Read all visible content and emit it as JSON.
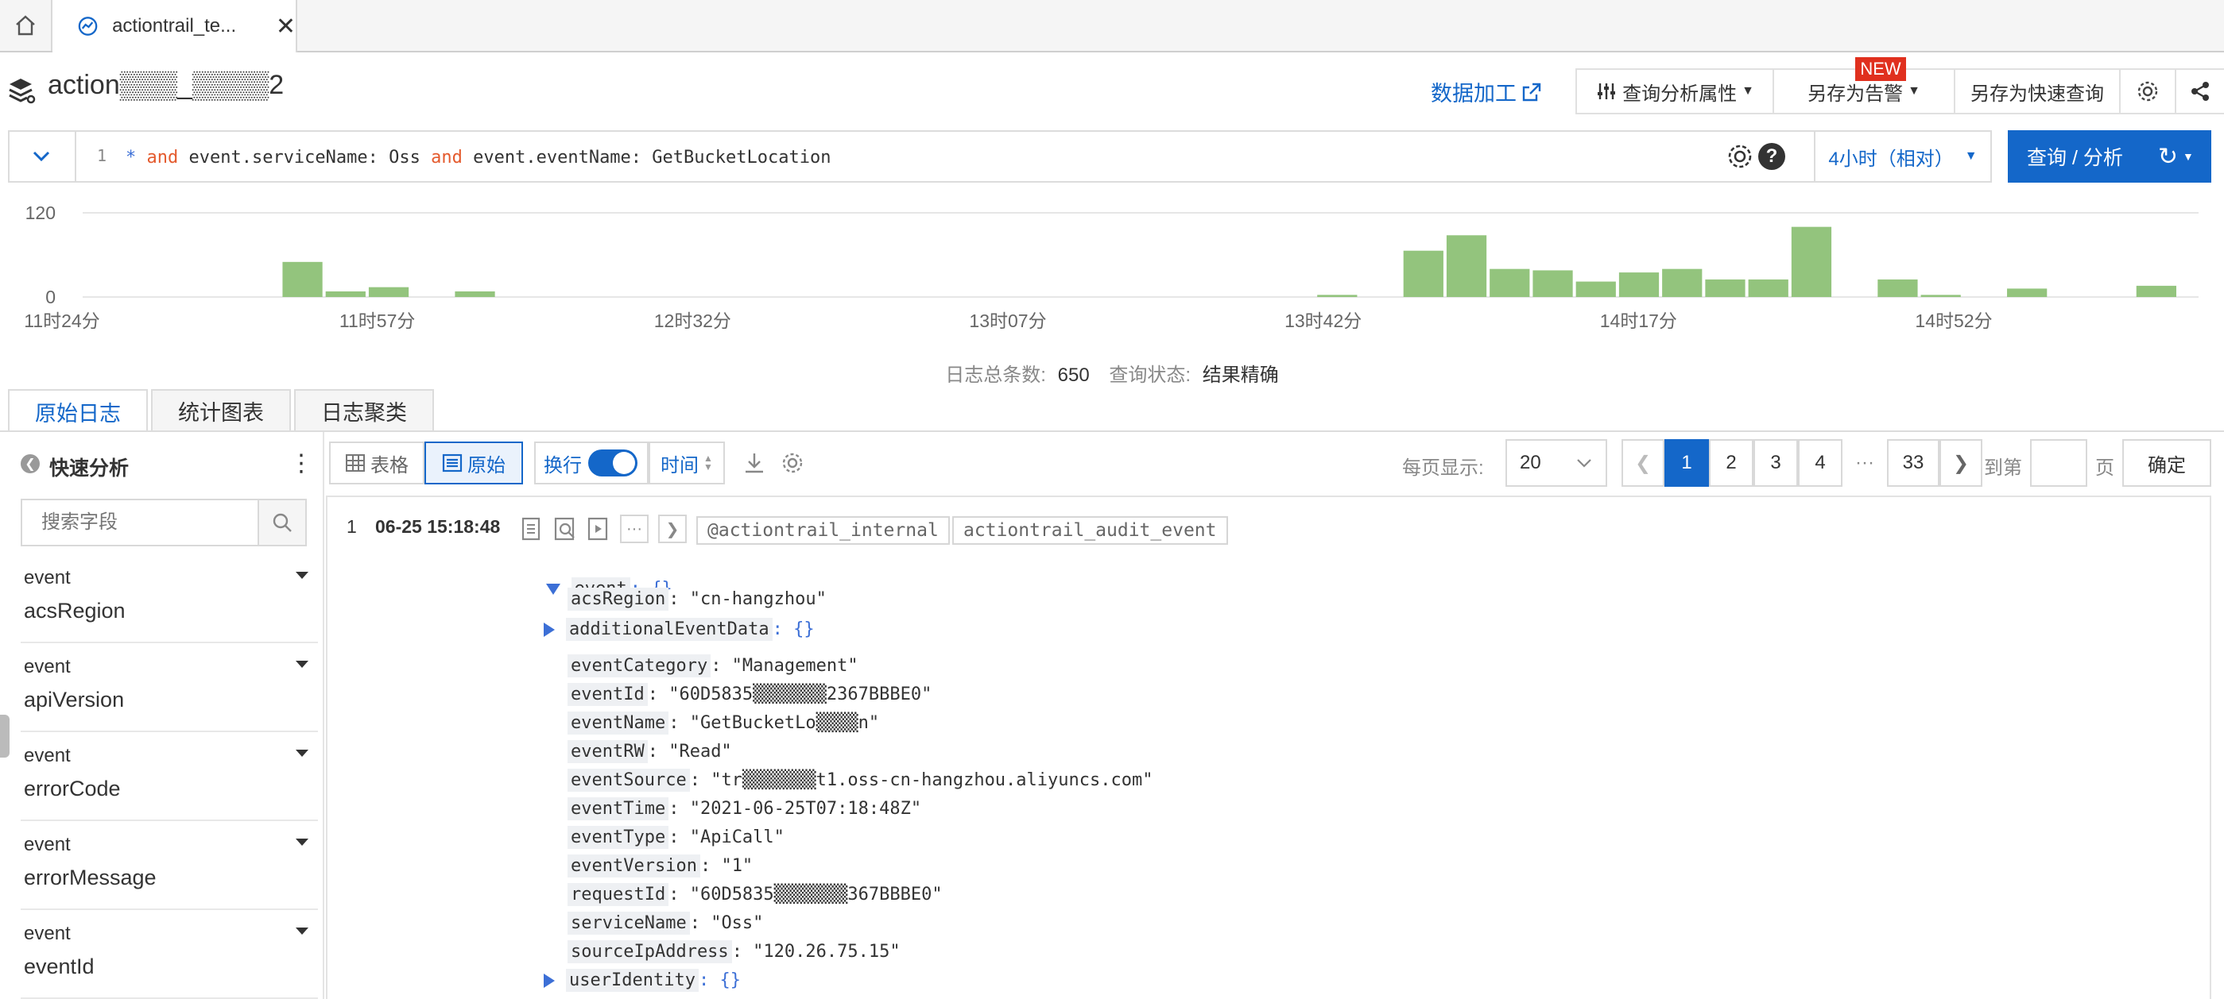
{
  "tabbar": {
    "active_tab_label": "actiontrail_te..."
  },
  "header": {
    "logstore_title": "action▒▒▒_▒▒▒▒2",
    "data_process_label": "数据加工",
    "query_props_label": "查询分析属性",
    "save_alert_label": "另存为告警",
    "new_badge": "NEW",
    "save_quick_label": "另存为快速查询"
  },
  "query": {
    "line_number": "1",
    "tokens": [
      "*",
      " and ",
      "event.serviceName: Oss",
      " and ",
      "event.eventName: GetBucketLocation"
    ],
    "time_range": "4小时（相对）",
    "search_button": "查询 / 分析"
  },
  "chart_data": {
    "type": "bar",
    "ylim": [
      0,
      120
    ],
    "yticks": [
      "120",
      "0"
    ],
    "xtick_labels": [
      "11时24分",
      "11时57分",
      "12时32分",
      "13时07分",
      "13时42分",
      "14时17分",
      "14时52分"
    ],
    "values": [
      0,
      0,
      0,
      0,
      0,
      0,
      50,
      8,
      14,
      0,
      8,
      0,
      0,
      0,
      0,
      0,
      0,
      0,
      0,
      0,
      0,
      0,
      0,
      0,
      0,
      0,
      0,
      0,
      0,
      0,
      3,
      0,
      66,
      88,
      40,
      38,
      22,
      35,
      40,
      25,
      25,
      100,
      0,
      25,
      3,
      0,
      12,
      0,
      0,
      16
    ],
    "grid": true
  },
  "summary": {
    "total_label": "日志总条数:",
    "total_value": "650",
    "status_label": "查询状态:",
    "status_value": "结果精确"
  },
  "tabs": [
    "原始日志",
    "统计图表",
    "日志聚类"
  ],
  "sidebar": {
    "title": "快速分析",
    "search_placeholder": "搜索字段",
    "fields": [
      {
        "prefix": "event",
        "name": "acsRegion"
      },
      {
        "prefix": "event",
        "name": "apiVersion"
      },
      {
        "prefix": "event",
        "name": "errorCode"
      },
      {
        "prefix": "event",
        "name": "errorMessage"
      },
      {
        "prefix": "event",
        "name": "eventId"
      }
    ]
  },
  "toolbar": {
    "table_label": "表格",
    "raw_label": "原始",
    "wrap_label": "换行",
    "time_label": "时间",
    "per_page_label": "每页显示:",
    "per_page_value": "20",
    "pages": [
      "1",
      "2",
      "3",
      "4",
      "···",
      "33"
    ],
    "goto_label": "到第",
    "page_suffix": "页",
    "confirm_label": "确定"
  },
  "log": {
    "index": "1",
    "time": "06-25 15:18:48",
    "tags": [
      "@actiontrail_internal",
      "actiontrail_audit_event"
    ],
    "root_key": "event",
    "root_val": ": {}",
    "fields": [
      {
        "key": "acsRegion",
        "val": ": \"cn-hangzhou\""
      },
      {
        "key": "additionalEventData",
        "val": ": {}"
      },
      {
        "key": "eventCategory",
        "val": ": \"Management\""
      },
      {
        "key": "eventId",
        "val": ": \"60D5835▒▒▒▒▒▒▒2367BBBE0\""
      },
      {
        "key": "eventName",
        "val": ": \"GetBucketLo▒▒▒▒n\""
      },
      {
        "key": "eventRW",
        "val": ": \"Read\""
      },
      {
        "key": "eventSource",
        "val": ": \"tr▒▒▒▒▒▒▒t1.oss-cn-hangzhou.aliyuncs.com\""
      },
      {
        "key": "eventTime",
        "val": ": \"2021-06-25T07:18:48Z\""
      },
      {
        "key": "eventType",
        "val": ": \"ApiCall\""
      },
      {
        "key": "eventVersion",
        "val": ": \"1\""
      },
      {
        "key": "requestId",
        "val": ": \"60D5835▒▒▒▒▒▒▒367BBBE0\""
      },
      {
        "key": "serviceName",
        "val": ": \"Oss\""
      },
      {
        "key": "sourceIpAddress",
        "val": ": \"120.26.75.15\""
      },
      {
        "key": "userIdentity",
        "val": ": {}"
      }
    ]
  },
  "colors": {
    "primary": "#1467c9",
    "bar": "#93c47d",
    "keyword": "#e45a2d",
    "new_badge": "#e0301e"
  }
}
